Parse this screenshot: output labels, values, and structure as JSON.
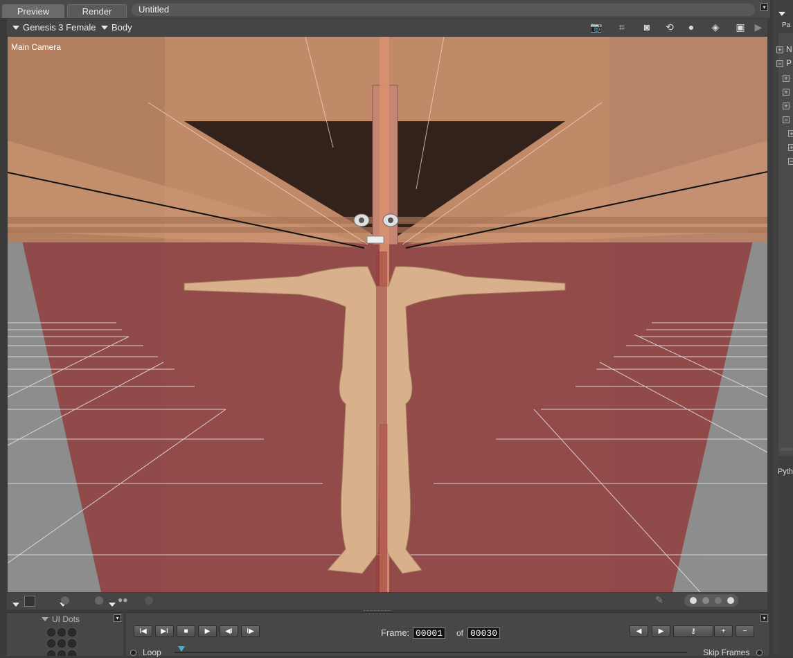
{
  "tabs": [
    {
      "label": "Preview"
    },
    {
      "label": "Render"
    }
  ],
  "document_title": "Untitled",
  "toolbar": {
    "figure_select": "Genesis 3 Female",
    "part_select": "Body",
    "icons": [
      "camera-icon",
      "camera-dashed-icon",
      "camera-frame-icon",
      "orbit-icon",
      "light-sphere-icon",
      "display-icon",
      "video-camera-icon",
      "video-camera-2-icon"
    ]
  },
  "viewport": {
    "camera_label": "Main Camera",
    "floor_color": "#8f4a49",
    "skin_color": "#d9b08c",
    "backdrop_color": "#c08a68"
  },
  "animation": {
    "frame_label": "Frame:",
    "current_frame": "00001",
    "of_label": "of",
    "total_frames": "00030",
    "loop_label": "Loop",
    "skip_frames_label": "Skip Frames"
  },
  "ui_dots": {
    "label": "UI Dots"
  },
  "right_panel": {
    "header_fragment": "Pa",
    "tree_items": [
      "N",
      "P"
    ],
    "python_label": "Pyth"
  }
}
